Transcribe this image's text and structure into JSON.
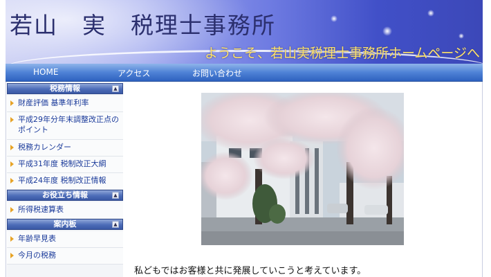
{
  "header": {
    "title": "若山　実　税理士事務所",
    "subtitle": "ようこそ、若山実税理士事務所ホームページへ"
  },
  "nav": {
    "items": [
      "HOME",
      "アクセス",
      "お問い合わせ"
    ]
  },
  "sidebar": {
    "sections": [
      {
        "title": "税務情報",
        "items": [
          "財産評価 基準年利率",
          "平成29年分年末調整改正点のポイント",
          "税務カレンダー",
          "平成31年度 税制改正大綱",
          "平成24年度 税制改正情報"
        ]
      },
      {
        "title": "お役立ち情報",
        "items": [
          "所得税速算表"
        ]
      },
      {
        "title": "案内板",
        "items": [
          "年齢早見表",
          "今月の税務"
        ]
      }
    ],
    "toggle_symbol": "▲"
  },
  "main": {
    "intro_text": "私どもではお客様と共に発展していこうと考えています。"
  },
  "colors": {
    "nav_bar": "#3d6fcb",
    "sidebar_link": "#1a3a9a",
    "bullet": "#e7a326",
    "subtitle": "#ffe36a"
  }
}
